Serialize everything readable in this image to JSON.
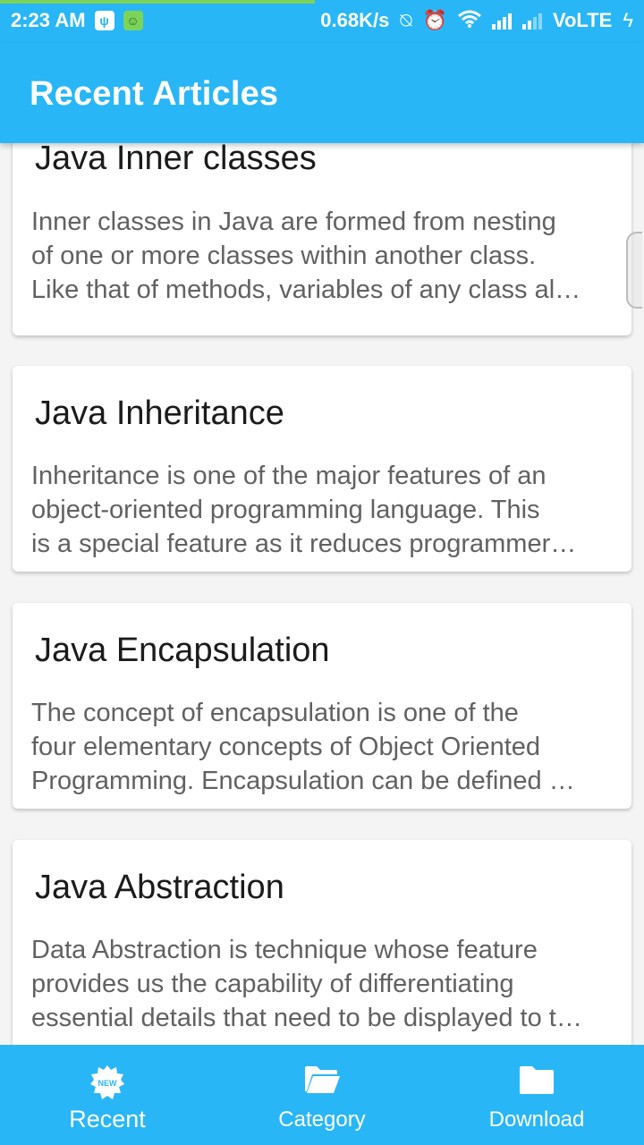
{
  "status_bar": {
    "time": "2:23 AM",
    "net_speed": "0.68K/s",
    "network": "VoLTE",
    "icons": [
      "usb-icon",
      "android-icon",
      "vibrate-off-icon",
      "alarm-icon",
      "wifi-icon",
      "signal-icon",
      "signal-icon",
      "charging-icon"
    ]
  },
  "app_bar": {
    "title": "Recent Articles"
  },
  "articles": [
    {
      "title": "Java Inner classes",
      "lines": [
        "Inner classes in Java are formed from nesting",
        "of one or more classes within another class.",
        "Like that of methods, variables of any class al…"
      ]
    },
    {
      "title": "Java Inheritance",
      "lines": [
        "Inheritance is one of the major features of an",
        "object-oriented programming language. This",
        "is a special feature as it reduces programmer…"
      ]
    },
    {
      "title": "Java Encapsulation",
      "lines": [
        "The concept of encapsulation is one of the",
        "four elementary concepts of Object Oriented",
        "Programming. Encapsulation can be defined …"
      ]
    },
    {
      "title": "Java Abstraction",
      "lines": [
        "Data Abstraction is technique whose feature",
        "provides us the capability of differentiating",
        "essential details that need to be displayed to t…"
      ]
    }
  ],
  "bottom_nav": {
    "items": [
      {
        "label": "Recent",
        "icon": "new-badge-icon",
        "active": true,
        "badge_text": "NEW"
      },
      {
        "label": "Category",
        "icon": "folder-open-icon",
        "active": false
      },
      {
        "label": "Download",
        "icon": "folder-icon",
        "active": false
      }
    ]
  },
  "colors": {
    "primary": "#29b6f6",
    "background": "#f4f4f4",
    "card": "#ffffff",
    "title_text": "#1b1b1b",
    "body_text": "#616161"
  }
}
